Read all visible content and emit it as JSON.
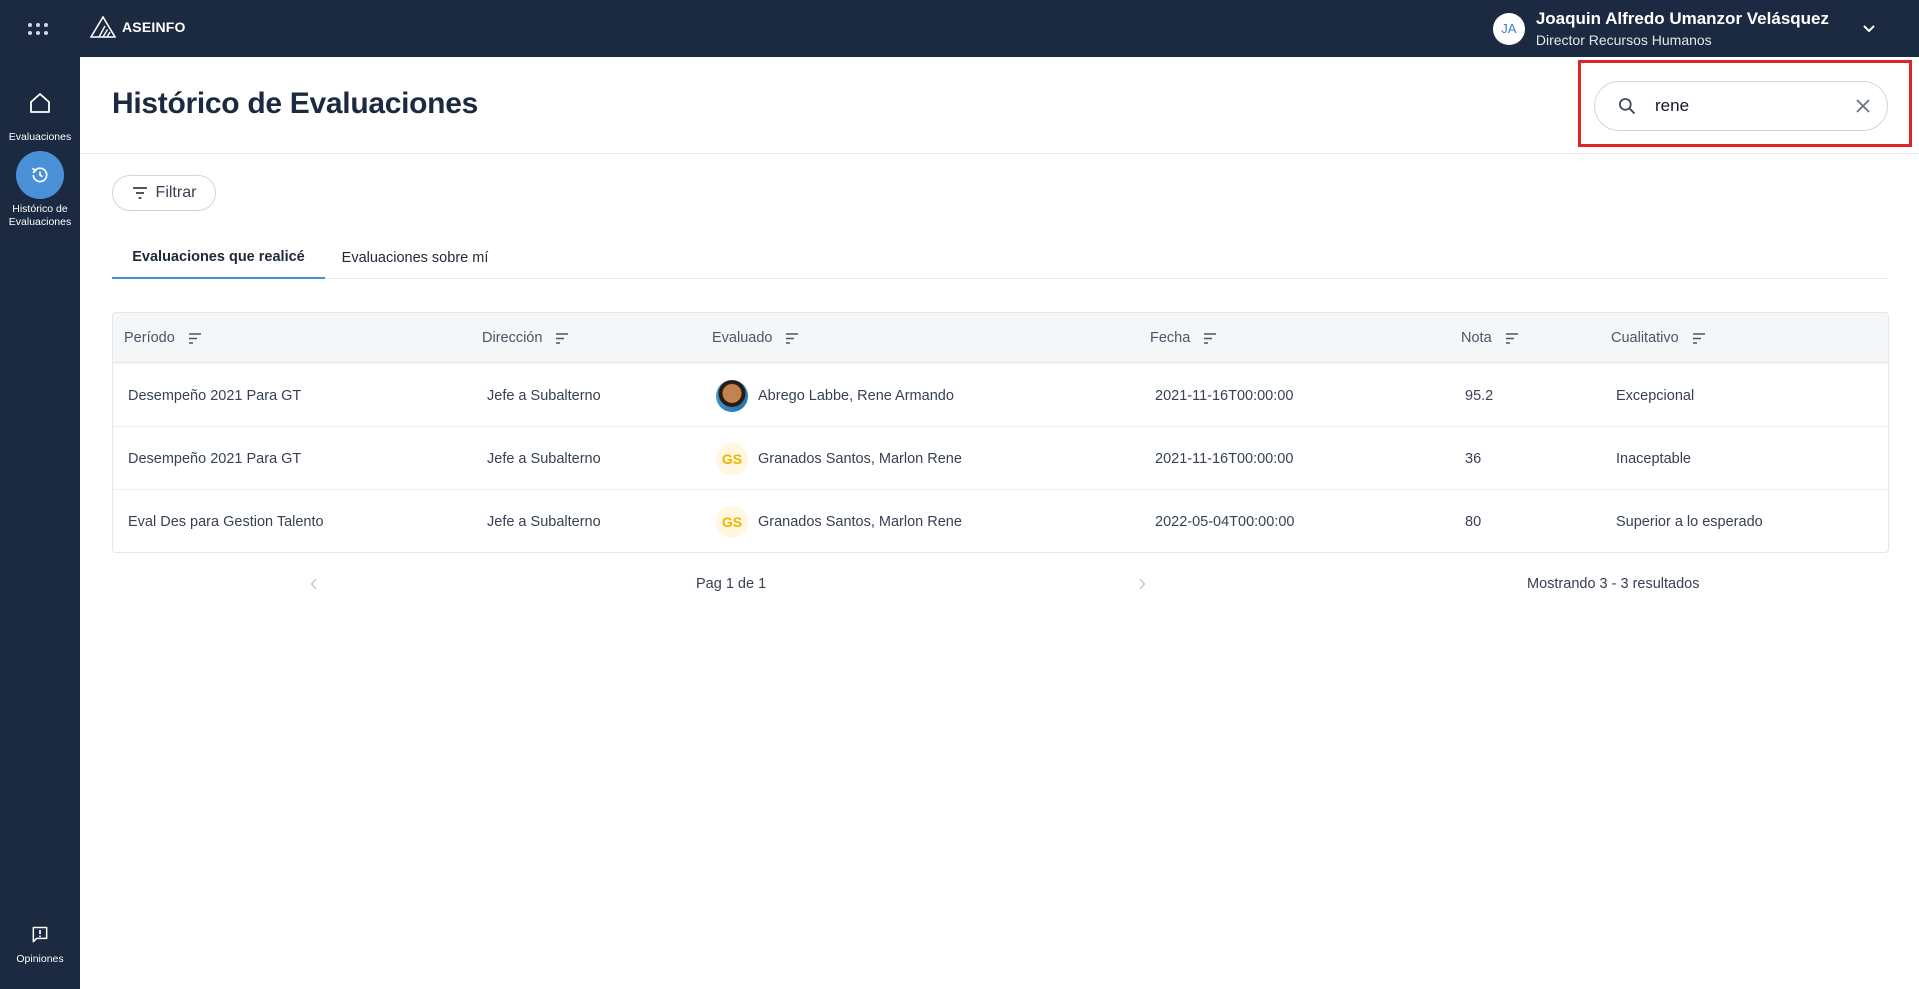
{
  "topbar": {
    "brand": "ASEINFO",
    "user": {
      "initials": "JA",
      "name": "Joaquin Alfredo Umanzor Velásquez",
      "role": "Director Recursos Humanos"
    }
  },
  "sidebar": {
    "items": [
      {
        "label": "Evaluaciones",
        "icon": "home-icon"
      },
      {
        "label": "Histórico de Evaluaciones",
        "icon": "history-icon",
        "active": true
      },
      {
        "label": "Opiniones",
        "icon": "feedback-icon"
      }
    ]
  },
  "header": {
    "title": "Histórico de Evaluaciones",
    "search_value": "rene"
  },
  "filter_label": "Filtrar",
  "tabs": [
    {
      "label": "Evaluaciones que realicé",
      "active": true
    },
    {
      "label": "Evaluaciones sobre mí",
      "active": false
    }
  ],
  "table": {
    "columns": [
      "Período",
      "Dirección",
      "Evaluado",
      "Fecha",
      "Nota",
      "Cualitativo"
    ],
    "rows": [
      {
        "periodo": "Desempeño 2021 Para GT",
        "direccion": "Jefe a Subalterno",
        "avatar": "photo",
        "avatar_text": "",
        "evaluado": "Abrego Labbe, Rene Armando",
        "fecha": "2021-11-16T00:00:00",
        "nota": "95.2",
        "cualitativo": "Excepcional"
      },
      {
        "periodo": "Desempeño 2021 Para GT",
        "direccion": "Jefe a Subalterno",
        "avatar": "initials",
        "avatar_text": "GS",
        "evaluado": "Granados Santos, Marlon Rene",
        "fecha": "2021-11-16T00:00:00",
        "nota": "36",
        "cualitativo": "Inaceptable"
      },
      {
        "periodo": "Eval Des para Gestion Talento",
        "direccion": "Jefe a Subalterno",
        "avatar": "initials",
        "avatar_text": "GS",
        "evaluado": "Granados Santos, Marlon Rene",
        "fecha": "2022-05-04T00:00:00",
        "nota": "80",
        "cualitativo": "Superior a lo esperado"
      }
    ]
  },
  "pagination": {
    "page_label": "Pag 1 de 1",
    "count_label": "Mostrando 3 - 3 resultados"
  },
  "colors": {
    "navy": "#1b2a40",
    "accent": "#4a90d9",
    "highlight": "#e02424",
    "initials_avatar": "#f0b400"
  }
}
